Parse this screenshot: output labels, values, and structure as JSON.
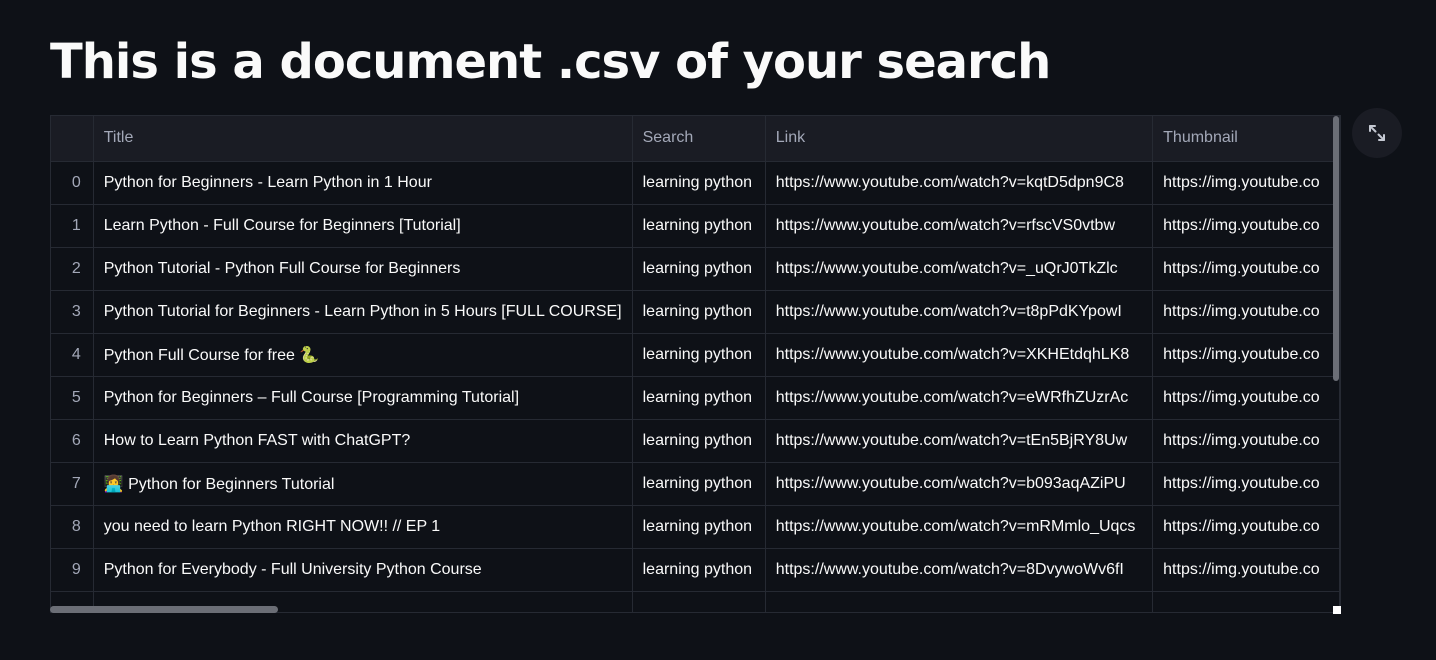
{
  "page": {
    "title": "This is a document .csv of your search"
  },
  "table": {
    "columns": [
      "",
      "Title",
      "Search",
      "Link",
      "Thumbnail"
    ],
    "rows": [
      {
        "index": "0",
        "title": "Python for Beginners - Learn Python in 1 Hour",
        "search": "learning python",
        "link": "https://www.youtube.com/watch?v=kqtD5dpn9C8",
        "thumbnail": "https://img.youtube.co"
      },
      {
        "index": "1",
        "title": "Learn Python - Full Course for Beginners [Tutorial]",
        "search": "learning python",
        "link": "https://www.youtube.com/watch?v=rfscVS0vtbw",
        "thumbnail": "https://img.youtube.co"
      },
      {
        "index": "2",
        "title": "Python Tutorial - Python Full Course for Beginners",
        "search": "learning python",
        "link": "https://www.youtube.com/watch?v=_uQrJ0TkZlc",
        "thumbnail": "https://img.youtube.co"
      },
      {
        "index": "3",
        "title": "Python Tutorial for Beginners - Learn Python in 5 Hours [FULL COURSE]",
        "search": "learning python",
        "link": "https://www.youtube.com/watch?v=t8pPdKYpowI",
        "thumbnail": "https://img.youtube.co"
      },
      {
        "index": "4",
        "title": "Python Full Course for free 🐍",
        "search": "learning python",
        "link": "https://www.youtube.com/watch?v=XKHEtdqhLK8",
        "thumbnail": "https://img.youtube.co"
      },
      {
        "index": "5",
        "title": "Python for Beginners – Full Course [Programming Tutorial]",
        "search": "learning python",
        "link": "https://www.youtube.com/watch?v=eWRfhZUzrAc",
        "thumbnail": "https://img.youtube.co"
      },
      {
        "index": "6",
        "title": "How to Learn Python FAST with ChatGPT?",
        "search": "learning python",
        "link": "https://www.youtube.com/watch?v=tEn5BjRY8Uw",
        "thumbnail": "https://img.youtube.co"
      },
      {
        "index": "7",
        "title": "👩‍💻 Python for Beginners Tutorial",
        "search": "learning python",
        "link": "https://www.youtube.com/watch?v=b093aqAZiPU",
        "thumbnail": "https://img.youtube.co"
      },
      {
        "index": "8",
        "title": "you need to learn Python RIGHT NOW!! // EP 1",
        "search": "learning python",
        "link": "https://www.youtube.com/watch?v=mRMmlo_Uqcs",
        "thumbnail": "https://img.youtube.co"
      },
      {
        "index": "9",
        "title": "Python for Everybody - Full University Python Course",
        "search": "learning python",
        "link": "https://www.youtube.com/watch?v=8DvywoWv6fI",
        "thumbnail": "https://img.youtube.co"
      },
      {
        "index": "10",
        "title": "",
        "search": "",
        "link": "",
        "thumbnail": ""
      }
    ]
  },
  "icons": {
    "expand": "expand-icon"
  },
  "colors": {
    "background": "#0e1117",
    "header_background": "#1a1c24",
    "border": "#262a33",
    "text": "#fafafa",
    "muted_text": "#a3a8b8"
  }
}
